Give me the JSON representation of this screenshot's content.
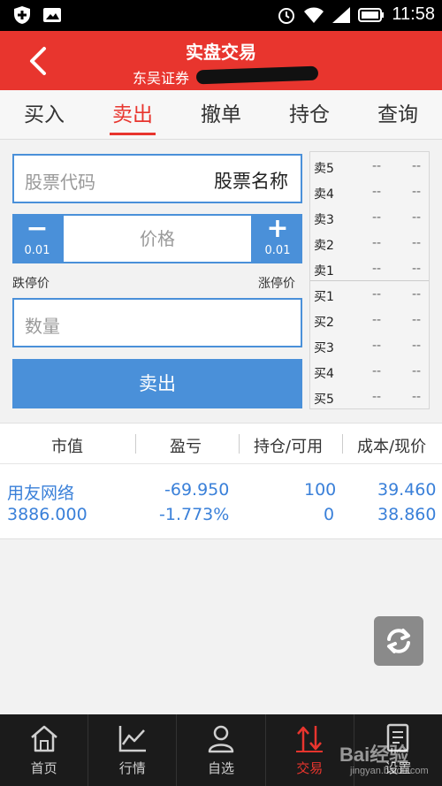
{
  "status_bar": {
    "time": "11:58"
  },
  "header": {
    "title": "实盘交易",
    "subtitle": "东吴证券"
  },
  "tabs": [
    {
      "label": "买入",
      "active": false
    },
    {
      "label": "卖出",
      "active": true
    },
    {
      "label": "撤单",
      "active": false
    },
    {
      "label": "持仓",
      "active": false
    },
    {
      "label": "查询",
      "active": false
    }
  ],
  "order_form": {
    "stock_code_placeholder": "股票代码",
    "stock_name_label": "股票名称",
    "price_placeholder": "价格",
    "minus_symbol": "−",
    "plus_symbol": "+",
    "price_step": "0.01",
    "limit_down_label": "跌停价",
    "limit_up_label": "涨停价",
    "quantity_placeholder": "数量",
    "sell_button": "卖出"
  },
  "order_book": {
    "rows": [
      {
        "label": "卖5",
        "price": "--",
        "volume": "--"
      },
      {
        "label": "卖4",
        "price": "--",
        "volume": "--"
      },
      {
        "label": "卖3",
        "price": "--",
        "volume": "--"
      },
      {
        "label": "卖2",
        "price": "--",
        "volume": "--"
      },
      {
        "label": "卖1",
        "price": "--",
        "volume": "--"
      },
      {
        "label": "买1",
        "price": "--",
        "volume": "--"
      },
      {
        "label": "买2",
        "price": "--",
        "volume": "--"
      },
      {
        "label": "买3",
        "price": "--",
        "volume": "--"
      },
      {
        "label": "买4",
        "price": "--",
        "volume": "--"
      },
      {
        "label": "买5",
        "price": "--",
        "volume": "--"
      }
    ]
  },
  "positions": {
    "headers": [
      "市值",
      "盈亏",
      "持仓/可用",
      "成本/现价"
    ],
    "rows": [
      {
        "name": "用友网络",
        "market_value": "3886.000",
        "profit": "-69.950",
        "profit_pct": "-1.773%",
        "holding": "100",
        "available": "0",
        "cost": "39.460",
        "current": "38.860"
      }
    ]
  },
  "bottom_nav": [
    {
      "label": "首页",
      "icon": "home-icon",
      "active": false
    },
    {
      "label": "行情",
      "icon": "chart-icon",
      "active": false
    },
    {
      "label": "自选",
      "icon": "user-icon",
      "active": false
    },
    {
      "label": "交易",
      "icon": "trade-icon",
      "active": true
    },
    {
      "label": "设置",
      "icon": "document-icon",
      "active": false
    }
  ],
  "watermark": {
    "text": "Bai经验",
    "sub": "jingyan.baidu.com"
  },
  "colors": {
    "accent_red": "#e8352e",
    "accent_blue": "#4a90d9",
    "value_blue": "#3a80d9"
  }
}
